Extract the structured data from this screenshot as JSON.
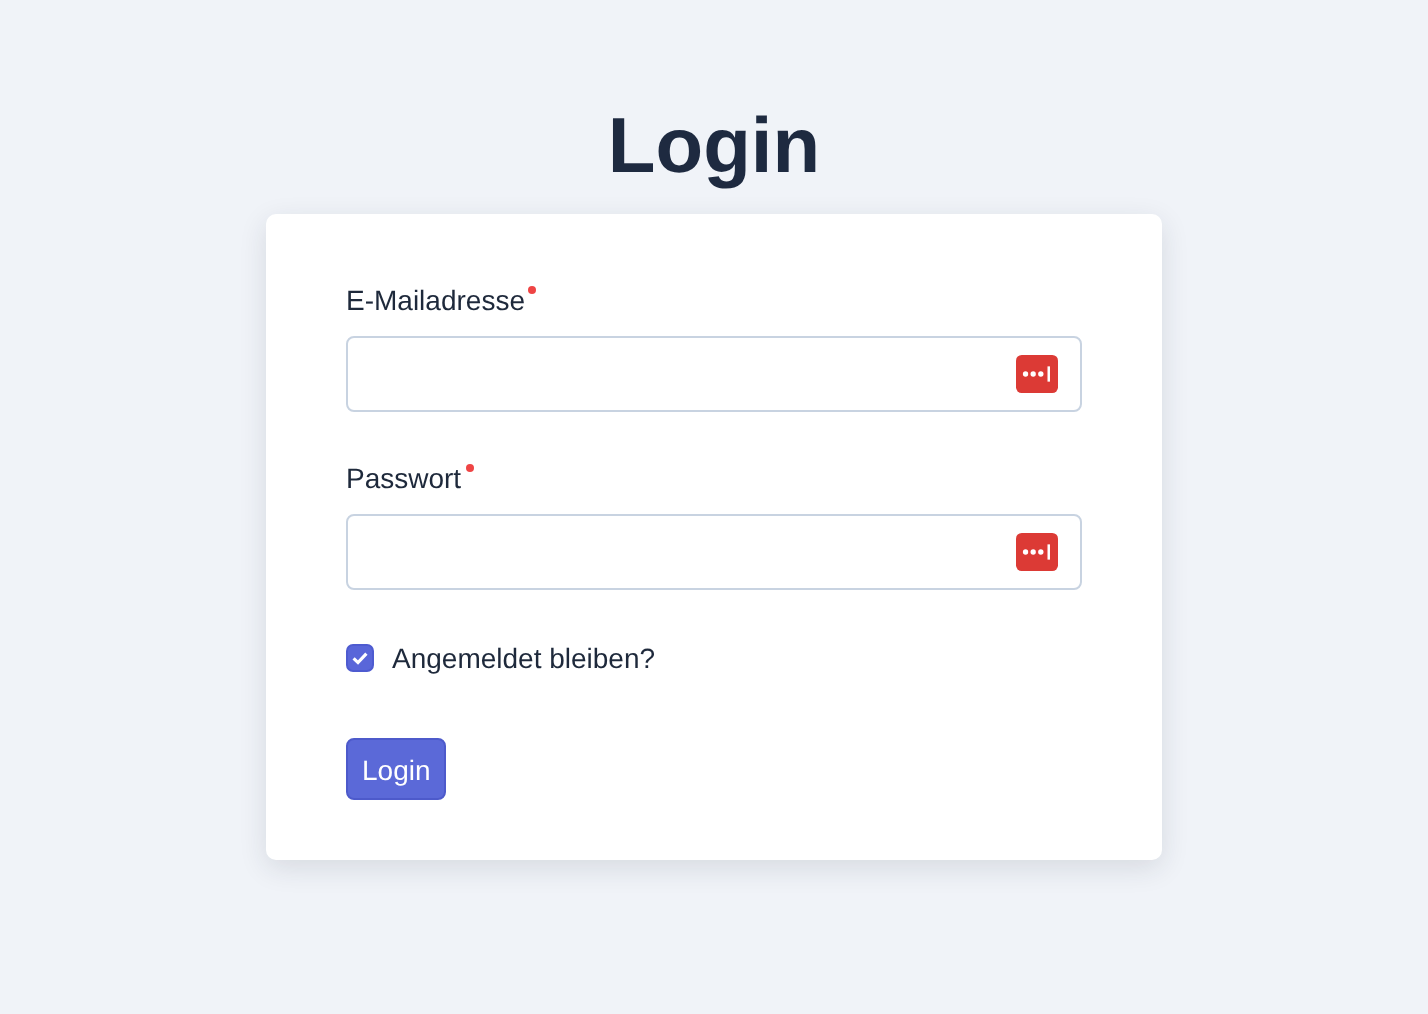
{
  "title": "Login",
  "fields": [
    {
      "label": "E-Mailadresse",
      "required": true
    },
    {
      "label": "Passwort",
      "required": true
    }
  ],
  "remember": {
    "label": "Angemeldet bleiben?",
    "checked": true
  },
  "submit": "Login"
}
